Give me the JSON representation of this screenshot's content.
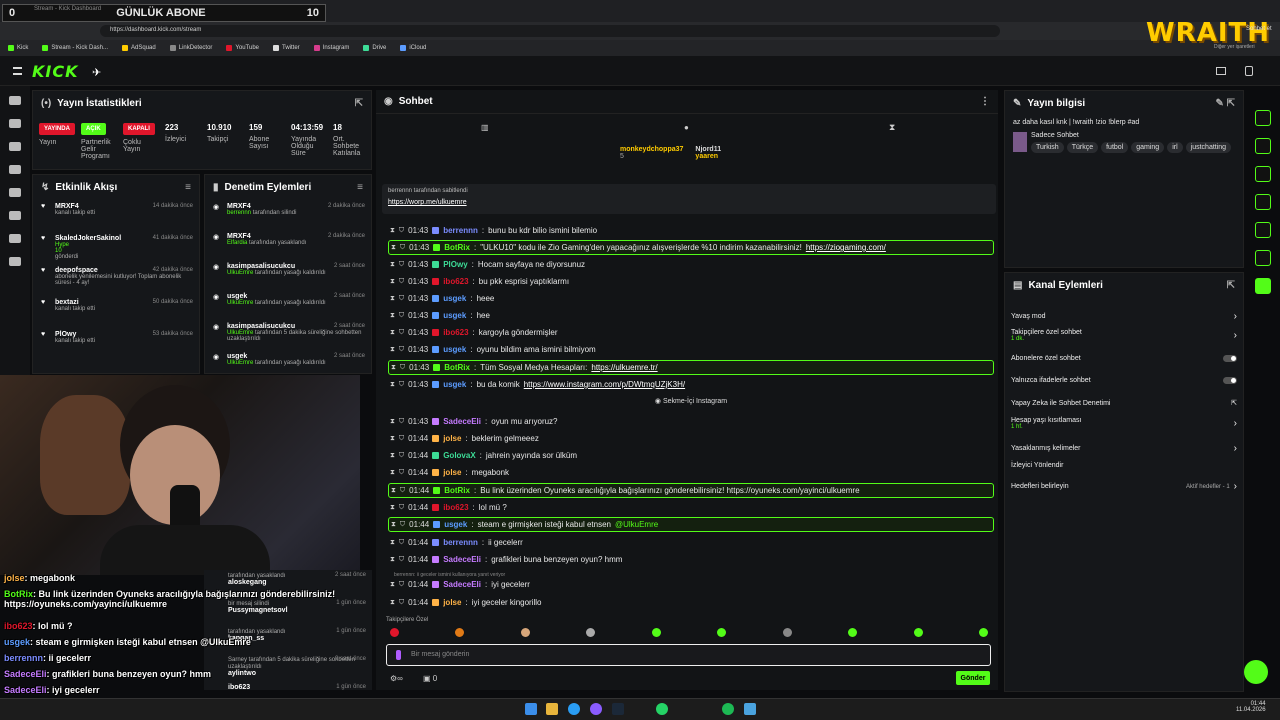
{
  "browser": {
    "tab_title": "Stream - Kick Dashboard",
    "url": "https://dashboard.kick.com/stream",
    "bookmarks": [
      "Kick",
      "Stream - Kick Dash...",
      "AdSquad",
      "LinkDetector",
      "YouTube",
      "Twitter",
      "Instagram",
      "Drive",
      "iCloud"
    ],
    "side_text": "Sohbet et",
    "side_text2": "Diğer yer işaretleri",
    "side_text3": "Tüm yer işaretleri"
  },
  "goal": {
    "left": "0",
    "title": "GÜNLÜK ABONE",
    "right": "10"
  },
  "overlay_logo": "WRAITH",
  "stats": {
    "title": "Yayın İstatistikleri",
    "items": [
      {
        "badge": "YAYINDA",
        "color": "#e0162b",
        "label": "Yayın"
      },
      {
        "badge": "AÇIK",
        "color": "#53fc18",
        "label": "Partnerlik Gelir Programı"
      },
      {
        "badge": "KAPALI",
        "color": "#e0162b",
        "label": "Çoklu Yayın"
      },
      {
        "value": "223",
        "label": "İzleyici"
      },
      {
        "value": "10.910",
        "label": "Takipçi"
      },
      {
        "value": "159",
        "label": "Abone Sayısı"
      },
      {
        "value": "04:13:59",
        "label": "Yayında Olduğu Süre"
      },
      {
        "value": "18",
        "label": "Ort. Sohbete Katılanla"
      }
    ]
  },
  "activity": {
    "title": "Etkinlik Akışı",
    "items": [
      {
        "name": "MRXF4",
        "desc": "kanalı takip etti",
        "time": "14 dakika önce"
      },
      {
        "name": "SkaledJokerSakinol",
        "desc": "Hype",
        "extra": "10",
        "extra2": "gönderdi",
        "time": "41 dakika önce"
      },
      {
        "name": "deepofspace",
        "desc": "abonelik yenilemesini kutluyor! Toplam abonelik süresi - 4 ay!",
        "time": "42 dakika önce"
      },
      {
        "name": "bextazi",
        "desc": "kanalı takip etti",
        "time": "50 dakika önce"
      },
      {
        "name": "PlOwy",
        "desc": "kanalı takip etti",
        "time": "53 dakika önce"
      }
    ]
  },
  "moderation": {
    "title": "Denetim Eylemleri",
    "items": [
      {
        "name": "MRXF4",
        "by": "berrennn",
        "desc": "tarafından silindi",
        "time": "2 dakika önce"
      },
      {
        "name": "MRXF4",
        "by": "Elfardia",
        "desc": "tarafından yasaklandı",
        "time": "2 dakika önce"
      },
      {
        "name": "kasimpasalisucukcu",
        "by": "UlkuEmre",
        "desc": "tarafından yasağı kaldırıldı",
        "time": "2 saat önce"
      },
      {
        "name": "usgek",
        "by": "UlkuEmre",
        "desc": "tarafından yasağı kaldırıldı",
        "time": "2 saat önce"
      },
      {
        "name": "kasimpasalisucukcu",
        "by": "UlkuEmre",
        "desc": "tarafından 5 dakika süreliğine sohbetten uzaklaştırıldı",
        "time": "2 saat önce"
      },
      {
        "name": "usgek",
        "by": "UlkuEmre",
        "desc": "tarafından yasağı kaldırıldı",
        "time": "2 saat önce"
      }
    ],
    "lower": [
      {
        "name": "aloskegang",
        "desc": "tarafından yasaklandı",
        "time": "2 saat önce"
      },
      {
        "name": "Pussymagnetsovl",
        "desc": "bir mesaj silindi",
        "time": "1 gün önce"
      },
      {
        "name": "kapgan_ss",
        "desc": "tarafından yasaklandı",
        "time": "1 gün önce"
      },
      {
        "name": "aylintwo",
        "desc": "Sarney tarafından 5 dakika süreliğine sohbetten uzaklaştırıldı",
        "time": "2 saat önce"
      },
      {
        "name": "ibo623",
        "desc": "",
        "time": "1 gün önce"
      }
    ]
  },
  "chat": {
    "title": "Sohbet",
    "top_users": [
      {
        "name": "monkeydchoppa37",
        "count": "5"
      },
      {
        "name": "Njord11",
        "count": "1"
      },
      {
        "name": "yaaren",
        "count": "1"
      }
    ],
    "pinned": {
      "by": "berrennn tarafından sabitlendi",
      "text": "https://worp.me/ulkuemre"
    },
    "messages": [
      {
        "time": "01:43",
        "user": "berrennn",
        "color": "#7b8cff",
        "text": "bunu bu kdr bilio ismini bilemio",
        "hl": false
      },
      {
        "time": "01:43",
        "user": "BotRix",
        "color": "#53fc18",
        "text": "\"ULKU10\" kodu ile Zio Gaming'den yapacağınız alışverişlerde %10 indirim kazanabilirsiniz!",
        "link": "https://ziogaming.com/",
        "hl": true
      },
      {
        "time": "01:43",
        "user": "PlOwy",
        "color": "#3ddc97",
        "text": "Hocam sayfaya ne diyorsunuz",
        "hl": false
      },
      {
        "time": "01:43",
        "user": "ibo623",
        "color": "#e0162b",
        "text": "bu pkk esprisi yaptıklarmı",
        "hl": false
      },
      {
        "time": "01:43",
        "user": "usgek",
        "color": "#5c9cff",
        "text": "heee",
        "hl": false
      },
      {
        "time": "01:43",
        "user": "usgek",
        "color": "#5c9cff",
        "text": "hee",
        "hl": false
      },
      {
        "time": "01:43",
        "user": "ibo623",
        "color": "#e0162b",
        "text": "kargoyla göndermişler",
        "hl": false
      },
      {
        "time": "01:43",
        "user": "usgek",
        "color": "#5c9cff",
        "text": "oyunu bildim ama ismini bilmiyom",
        "hl": false
      },
      {
        "time": "01:43",
        "user": "BotRix",
        "color": "#53fc18",
        "text": "Tüm Sosyal Medya Hesapları:",
        "link": "https://ulkuemre.tr/",
        "hl": true
      },
      {
        "time": "01:43",
        "user": "usgek",
        "color": "#5c9cff",
        "text": "bu da komik",
        "link": "https://www.instagram.com/p/DWtmqUZjK3H/",
        "hl": false
      },
      {
        "time": "01:43",
        "user": "SadeceEli",
        "color": "#c57bff",
        "text": "oyun mu arıyoruz?",
        "hl": false
      },
      {
        "time": "01:44",
        "user": "jolse",
        "color": "#ffb347",
        "text": "beklerim gelmeeez",
        "hl": false
      },
      {
        "time": "01:44",
        "user": "GolovaX",
        "color": "#3ddc97",
        "text": "jahrein yayında sor ülküm",
        "hl": false
      },
      {
        "time": "01:44",
        "user": "jolse",
        "color": "#ffb347",
        "text": "megabonk",
        "hl": false
      },
      {
        "time": "01:44",
        "user": "BotRix",
        "color": "#53fc18",
        "text": "Bu link üzerinden Oyuneks aracılığıyla bağışlarınızı gönderebilirsiniz! https://oyuneks.com/yayinci/ulkuemre",
        "hl": true
      },
      {
        "time": "01:44",
        "user": "ibo623",
        "color": "#e0162b",
        "text": "lol mü ?",
        "hl": false
      },
      {
        "time": "01:44",
        "user": "usgek",
        "color": "#5c9cff",
        "text": "steam e girmişken isteği kabul etnsen",
        "mention": "@UlkuEmre",
        "hl": true
      },
      {
        "time": "01:44",
        "user": "berrennn",
        "color": "#7b8cff",
        "text": "ii gecelerr",
        "hl": false
      },
      {
        "time": "01:44",
        "user": "SadeceEli",
        "color": "#c57bff",
        "text": "grafikleri buna benzeyen oyun? hmm",
        "hl": false
      },
      {
        "time": "01:44",
        "user": "SadeceEli",
        "color": "#c57bff",
        "text": "iyi gecelerr",
        "hl": false
      },
      {
        "time": "01:44",
        "user": "jolse",
        "color": "#ffb347",
        "text": "iyi geceler kingorillo",
        "hl": false
      }
    ],
    "separator": "Sekme-İçi Instagram",
    "reply_hint": "berrennn: ii geceler ismini kullanıyora yanıt veriyor",
    "followers_label": "Takipçilere Özel",
    "input_placeholder": "Bir mesaj gönderin",
    "send_label": "Gönder",
    "counter": "0"
  },
  "stream_info": {
    "title": "Yayın bilgisi",
    "stream_title": "az daha kasıl knk | !wraith !zio !blerp #ad",
    "category": "Sadece Sohbet",
    "tags": [
      "Turkish",
      "Türkçe",
      "futbol",
      "gaming",
      "irl",
      "justchatting"
    ]
  },
  "channel_actions": {
    "title": "Kanal Eylemleri",
    "items": [
      {
        "label": "Yavaş mod",
        "ctrl": "arrow"
      },
      {
        "label": "Takipçilere özel sohbet",
        "sub": "1 dk.",
        "ctrl": "arrow"
      },
      {
        "label": "Abonelere özel sohbet",
        "ctrl": "toggle"
      },
      {
        "label": "Yalnızca ifadelerle sohbet",
        "ctrl": "toggle"
      },
      {
        "label": "Yapay Zeka ile Sohbet Denetimi",
        "ctrl": "ext"
      },
      {
        "label": "Hesap yaşı kısıtlaması",
        "sub": "1 hf.",
        "ctrl": "arrow"
      },
      {
        "label": "Yasaklanmış kelimeler",
        "ctrl": "arrow"
      },
      {
        "label": "İzleyici Yönlendir",
        "ctrl": "none"
      },
      {
        "label": "Hedefleri belirleyin",
        "sub_right": "Aktif hedefler - 1",
        "ctrl": "arrow"
      }
    ]
  },
  "overlay_chat": [
    {
      "user": "jolse",
      "color": "#ffb347",
      "text": "megabonk"
    },
    {
      "user": "BotRix",
      "color": "#53fc18",
      "text": "Bu link üzerinden Oyuneks aracılığıyla bağışlarınızı gönderebilirsiniz! https://oyuneks.com/yayinci/ulkuemre"
    },
    {
      "user": "ibo623",
      "color": "#e0162b",
      "text": "lol mü ?"
    },
    {
      "user": "usgek",
      "color": "#5c9cff",
      "text": "steam e girmişken isteği kabul etnsen @UlkuEmre"
    },
    {
      "user": "berrennn",
      "color": "#7b8cff",
      "text": "ii gecelerr"
    },
    {
      "user": "SadeceEli",
      "color": "#c57bff",
      "text": "grafikleri buna benzeyen oyun? hmm"
    },
    {
      "user": "SadeceEli",
      "color": "#c57bff",
      "text": "iyi gecelerr"
    },
    {
      "user": "jolse",
      "color": "#ffb347",
      "text": "iyi geceler kingorillo"
    }
  ],
  "taskbar": {
    "time": "01:44",
    "date": "11.04.2026"
  }
}
